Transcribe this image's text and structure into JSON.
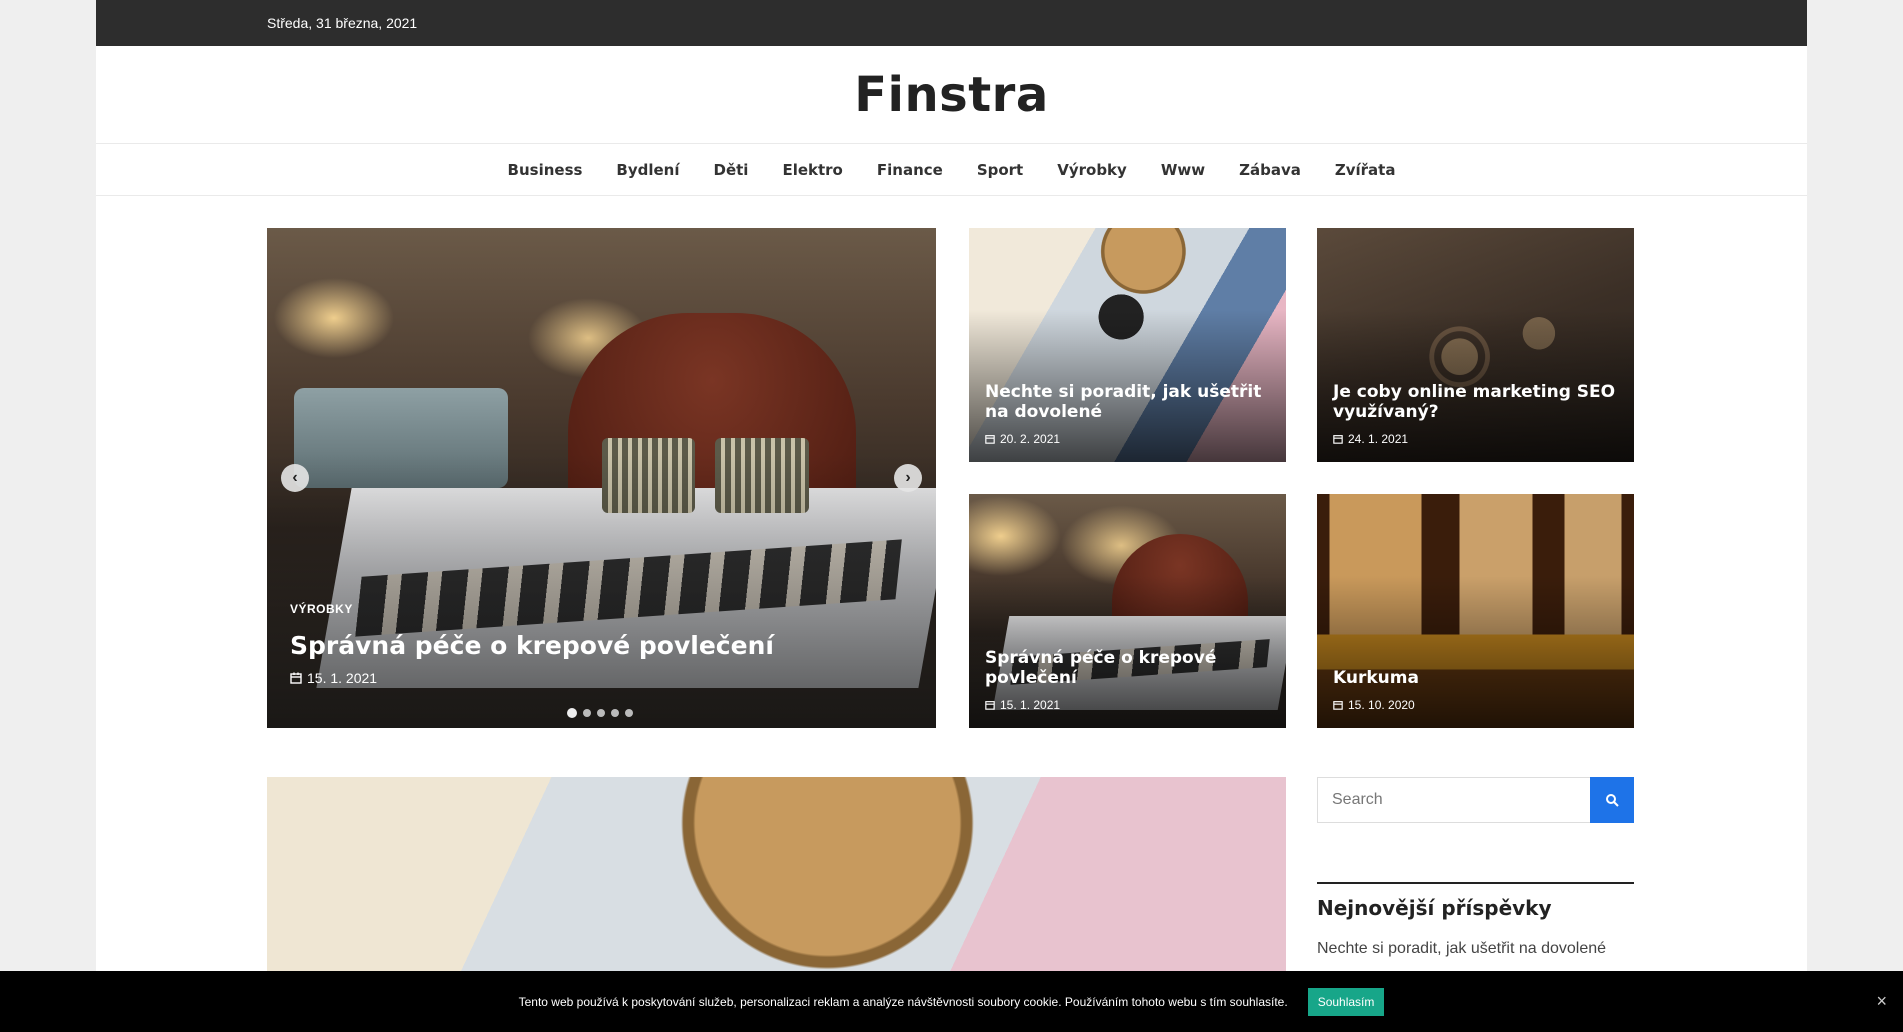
{
  "topbar": {
    "date": "Středa, 31 března, 2021"
  },
  "site": {
    "title": "Finstra"
  },
  "nav": [
    "Business",
    "Bydlení",
    "Děti",
    "Elektro",
    "Finance",
    "Sport",
    "Výrobky",
    "Www",
    "Zábava",
    "Zvířata"
  ],
  "slider": {
    "category": "VÝROBKY",
    "title": "Správná péče o krepové povlečení",
    "date": "15. 1. 2021",
    "prev_icon": "chevron-left-icon",
    "next_icon": "chevron-right-icon",
    "slide_count": 5,
    "active_slide": 1
  },
  "cards": [
    {
      "title": "Nechte si poradit, jak ušetřit na dovolené",
      "date": "20. 2. 2021"
    },
    {
      "title": "Je coby online marketing SEO využívaný?",
      "date": "24. 1. 2021"
    },
    {
      "title": "Správná péče o krepové povlečení",
      "date": "15. 1. 2021"
    },
    {
      "title": "Kurkuma",
      "date": "15. 10. 2020"
    }
  ],
  "search": {
    "placeholder": "Search",
    "icon": "search-icon"
  },
  "sidebar": {
    "heading": "Nejnovější příspěvky",
    "posts": [
      "Nechte si poradit, jak ušetřit na dovolené"
    ]
  },
  "cookie": {
    "text": "Tento web používá k poskytování služeb, personalizaci reklam a analýze návštěvnosti soubory cookie. Používáním tohoto webu s tím souhlasíte.",
    "accept": "Souhlasím",
    "close": "×"
  },
  "colors": {
    "topbar": "#2d2d2d",
    "accent": "#1e73e8",
    "cookie_button": "#17a689"
  }
}
